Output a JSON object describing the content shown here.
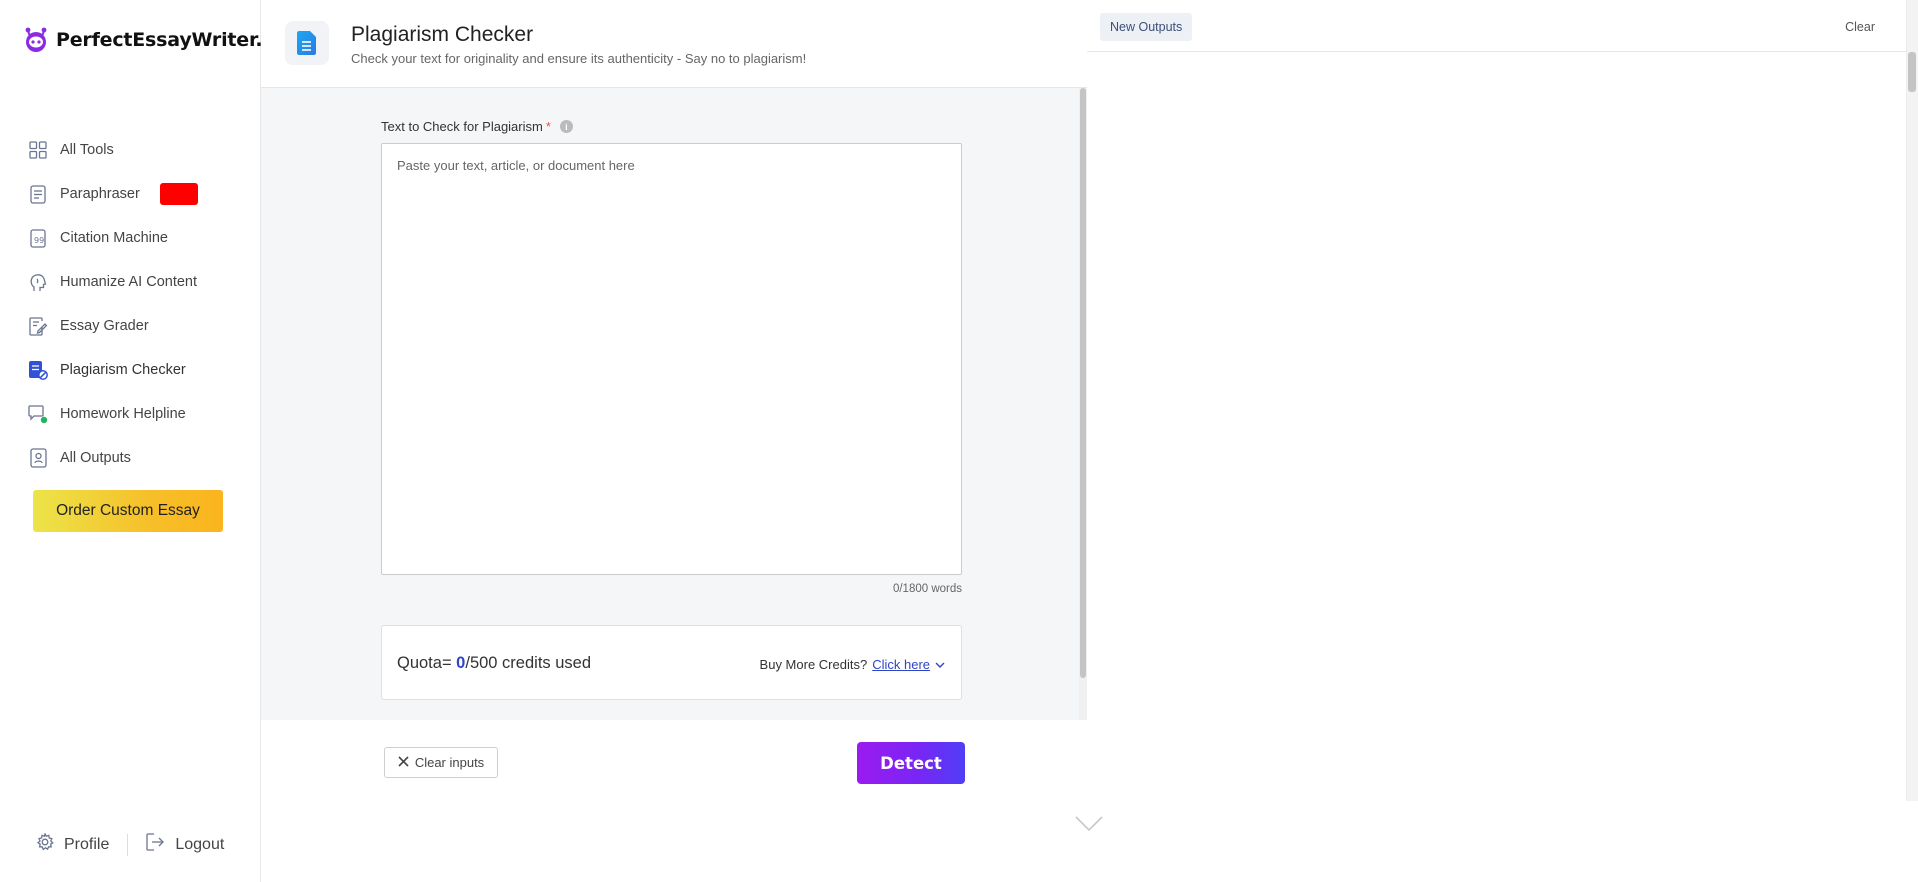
{
  "brand": {
    "name": "PerfectEssayWriter.ai",
    "accent": "#8a2be2"
  },
  "sidebar": {
    "items": [
      {
        "label": "All Tools",
        "icon": "grid-icon"
      },
      {
        "label": "Paraphraser",
        "icon": "document-lines-icon",
        "badge_color": "#ff0000"
      },
      {
        "label": "Citation Machine",
        "icon": "quote-document-icon"
      },
      {
        "label": "Humanize AI Content",
        "icon": "head-icon"
      },
      {
        "label": "Essay Grader",
        "icon": "edit-document-icon"
      },
      {
        "label": "Plagiarism Checker",
        "icon": "shield-document-icon",
        "active": true
      },
      {
        "label": "Homework Helpline",
        "icon": "chat-icon"
      },
      {
        "label": "All Outputs",
        "icon": "archive-icon"
      }
    ],
    "order_button": "Order Custom Essay",
    "profile": "Profile",
    "logout": "Logout"
  },
  "tool": {
    "title": "Plagiarism Checker",
    "subtitle": "Check your text for originality and ensure its authenticity - Say no to plagiarism!",
    "field_label": "Text to Check for Plagiarism",
    "required_mark": "*",
    "info": "i",
    "placeholder": "Paste your text, article, or document here",
    "word_count": "0/1800 words",
    "quota": {
      "prefix": "Quota= ",
      "used": "0",
      "suffix": "/500 credits used"
    },
    "buy_more": {
      "text": "Buy More Credits?",
      "link": "Click here"
    },
    "clear_button": "Clear inputs",
    "detect_button": "Detect"
  },
  "outputs": {
    "new_outputs": "New Outputs",
    "clear": "Clear"
  }
}
